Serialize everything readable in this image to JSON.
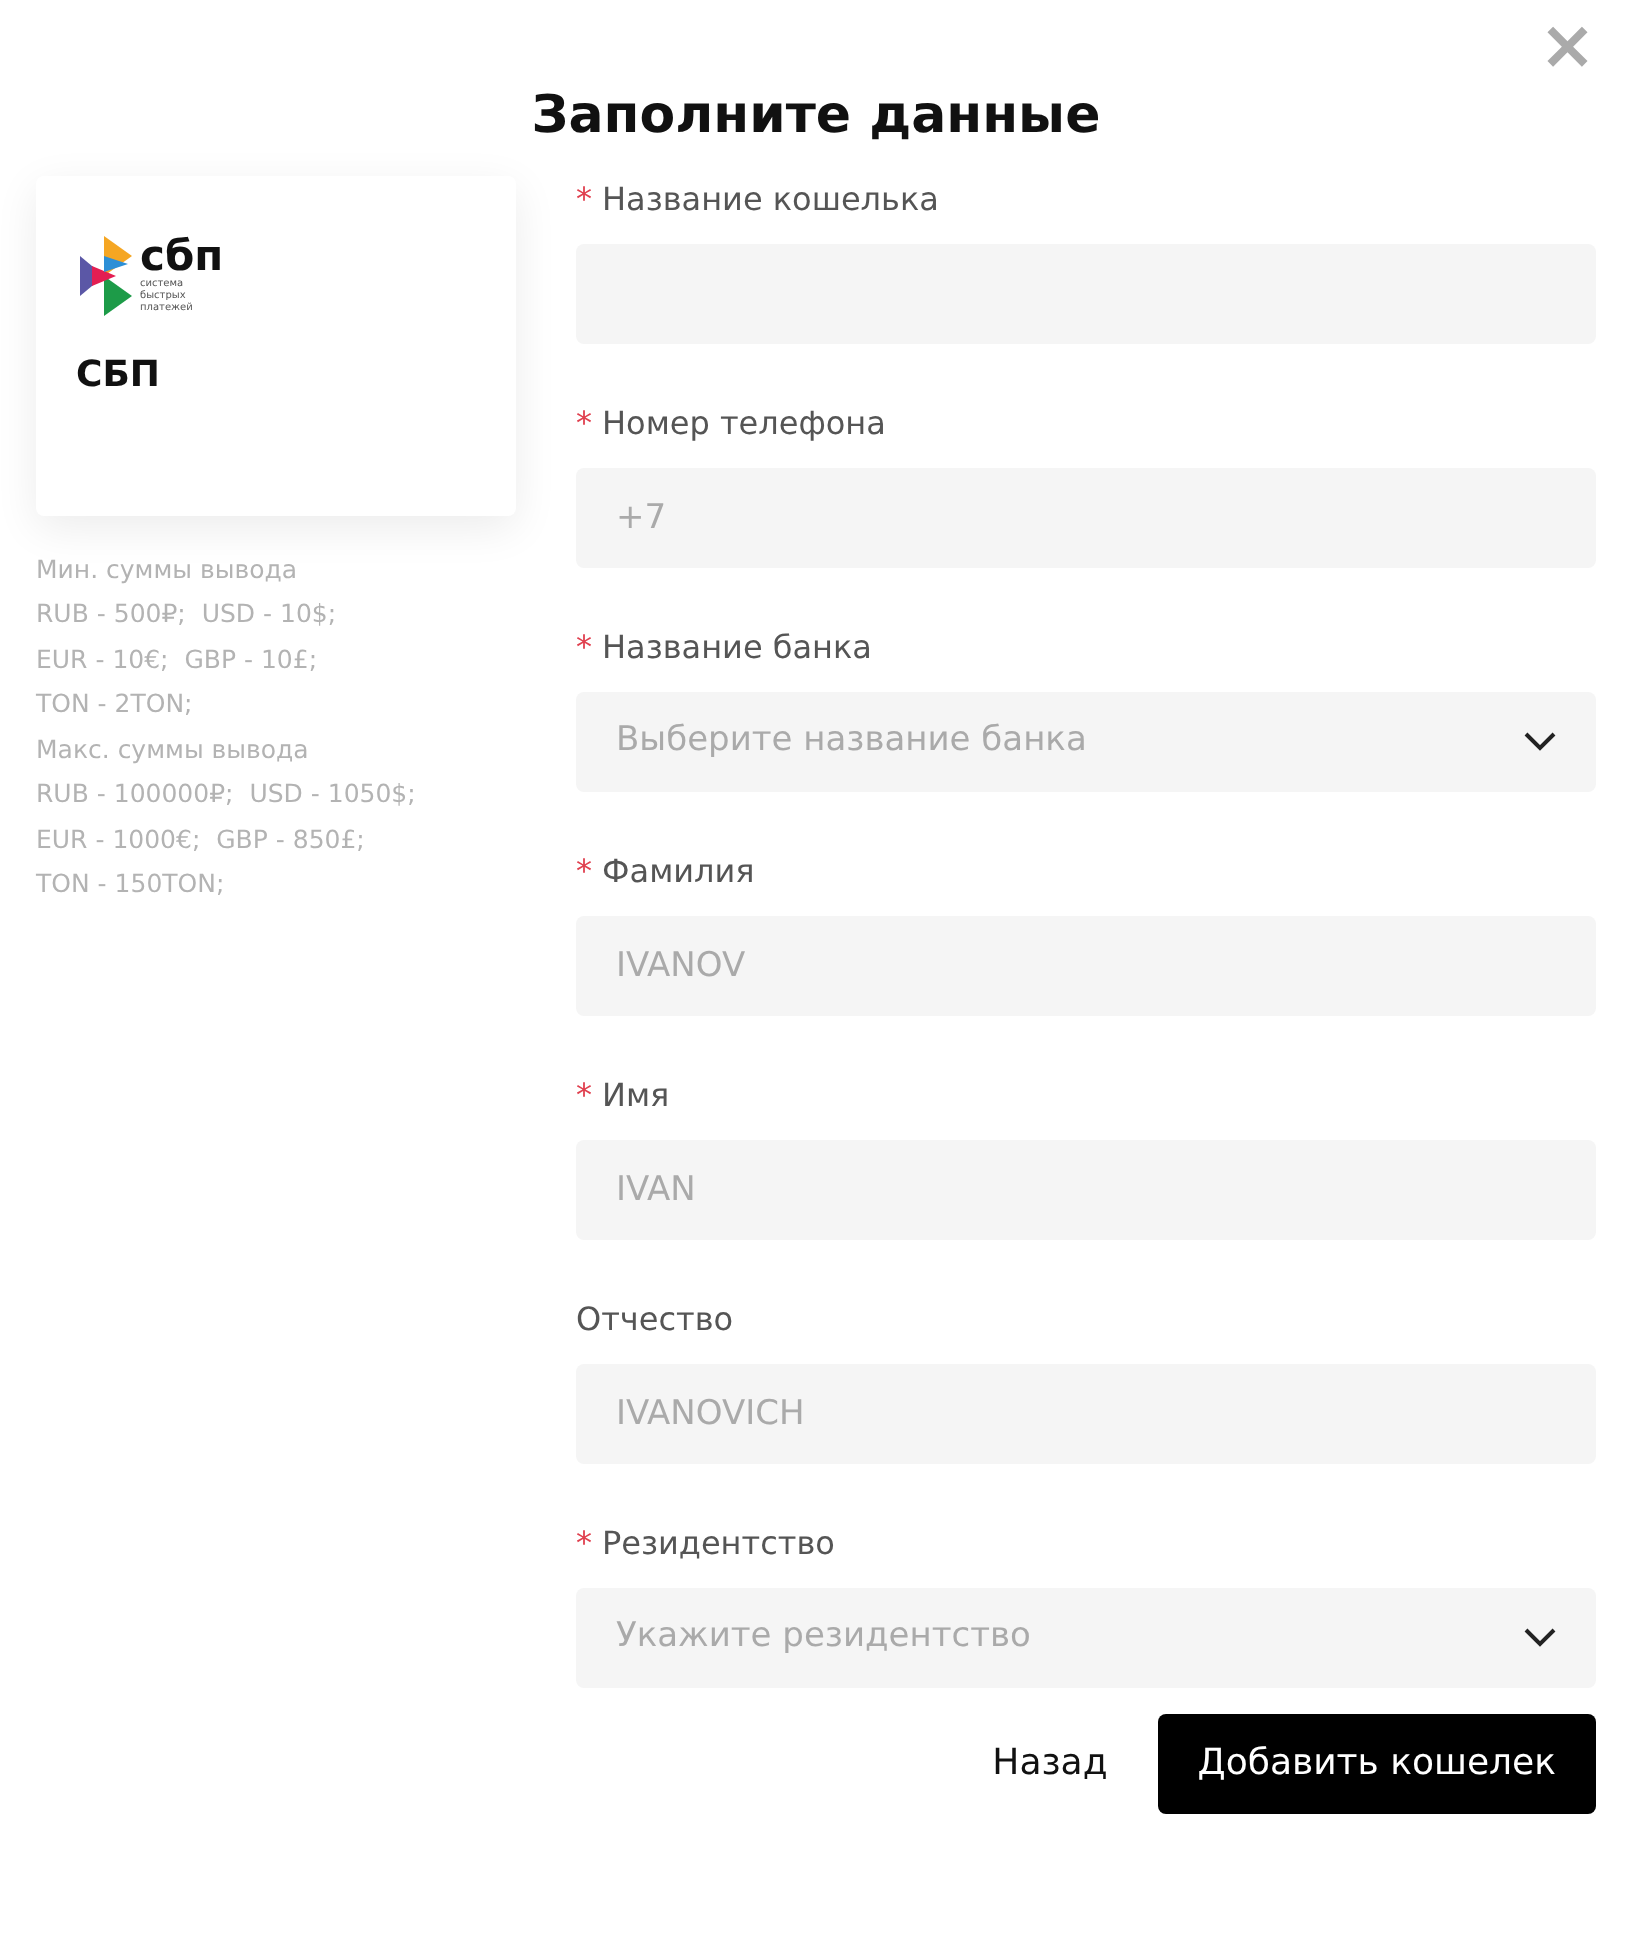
{
  "dialog": {
    "title": "Заполните данные",
    "close": "×"
  },
  "method": {
    "logo_word": "сбп",
    "logo_tagline": "система быстрых платежей",
    "name": "СБП",
    "limits": [
      "Мин. суммы вывода",
      "RUB - 500₽;  USD - 10$;",
      "EUR - 10€;  GBP - 10£;",
      "TON - 2TON;",
      "Макс. суммы вывода",
      "RUB - 100000₽;  USD - 1050$;",
      "EUR - 1000€;  GBP - 850£;",
      "TON - 150TON;"
    ]
  },
  "fields": [
    {
      "kind": "input",
      "required_mark": "*",
      "label": "Название кошелька"
    },
    {
      "kind": "input",
      "required_mark": "*",
      "label": "Номер телефона",
      "placeholder": "+7"
    },
    {
      "kind": "select",
      "required_mark": "*",
      "label": "Название банка",
      "placeholder": "Выберите название банка"
    },
    {
      "kind": "input",
      "required_mark": "*",
      "label": "Фамилия",
      "placeholder": "IVANOV"
    },
    {
      "kind": "input",
      "required_mark": "*",
      "label": "Имя",
      "placeholder": "IVAN"
    },
    {
      "kind": "input",
      "label": "Отчество",
      "placeholder": "IVANOVICH"
    },
    {
      "kind": "select",
      "required_mark": "*",
      "label": "Резидентство",
      "placeholder": "Укажите резидентство"
    }
  ],
  "buttons": [
    {
      "kind": "link",
      "label": "Назад"
    },
    {
      "kind": "primary",
      "label": "Добавить кошелек"
    }
  ]
}
